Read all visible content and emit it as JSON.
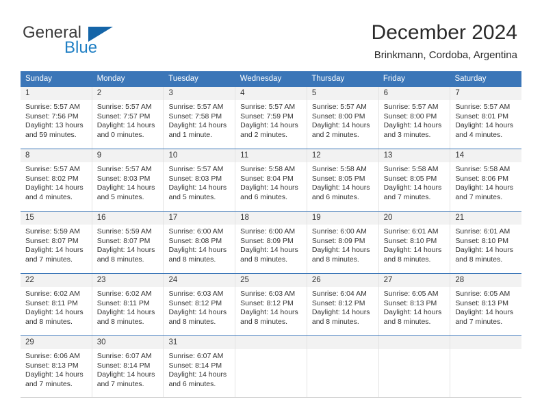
{
  "brand": {
    "name_part1": "General",
    "name_part2": "Blue"
  },
  "header": {
    "title": "December 2024",
    "subtitle": "Brinkmann, Cordoba, Argentina"
  },
  "colors": {
    "header_blue": "#3b76b8",
    "brand_blue": "#1f7fc4",
    "daynum_band": "#f2f2f2",
    "text": "#333333"
  },
  "weekdays": [
    "Sunday",
    "Monday",
    "Tuesday",
    "Wednesday",
    "Thursday",
    "Friday",
    "Saturday"
  ],
  "weeks": [
    [
      {
        "day": "1",
        "sunrise": "Sunrise: 5:57 AM",
        "sunset": "Sunset: 7:56 PM",
        "daylight_line1": "Daylight: 13 hours",
        "daylight_line2": "and 59 minutes."
      },
      {
        "day": "2",
        "sunrise": "Sunrise: 5:57 AM",
        "sunset": "Sunset: 7:57 PM",
        "daylight_line1": "Daylight: 14 hours",
        "daylight_line2": "and 0 minutes."
      },
      {
        "day": "3",
        "sunrise": "Sunrise: 5:57 AM",
        "sunset": "Sunset: 7:58 PM",
        "daylight_line1": "Daylight: 14 hours",
        "daylight_line2": "and 1 minute."
      },
      {
        "day": "4",
        "sunrise": "Sunrise: 5:57 AM",
        "sunset": "Sunset: 7:59 PM",
        "daylight_line1": "Daylight: 14 hours",
        "daylight_line2": "and 2 minutes."
      },
      {
        "day": "5",
        "sunrise": "Sunrise: 5:57 AM",
        "sunset": "Sunset: 8:00 PM",
        "daylight_line1": "Daylight: 14 hours",
        "daylight_line2": "and 2 minutes."
      },
      {
        "day": "6",
        "sunrise": "Sunrise: 5:57 AM",
        "sunset": "Sunset: 8:00 PM",
        "daylight_line1": "Daylight: 14 hours",
        "daylight_line2": "and 3 minutes."
      },
      {
        "day": "7",
        "sunrise": "Sunrise: 5:57 AM",
        "sunset": "Sunset: 8:01 PM",
        "daylight_line1": "Daylight: 14 hours",
        "daylight_line2": "and 4 minutes."
      }
    ],
    [
      {
        "day": "8",
        "sunrise": "Sunrise: 5:57 AM",
        "sunset": "Sunset: 8:02 PM",
        "daylight_line1": "Daylight: 14 hours",
        "daylight_line2": "and 4 minutes."
      },
      {
        "day": "9",
        "sunrise": "Sunrise: 5:57 AM",
        "sunset": "Sunset: 8:03 PM",
        "daylight_line1": "Daylight: 14 hours",
        "daylight_line2": "and 5 minutes."
      },
      {
        "day": "10",
        "sunrise": "Sunrise: 5:57 AM",
        "sunset": "Sunset: 8:03 PM",
        "daylight_line1": "Daylight: 14 hours",
        "daylight_line2": "and 5 minutes."
      },
      {
        "day": "11",
        "sunrise": "Sunrise: 5:58 AM",
        "sunset": "Sunset: 8:04 PM",
        "daylight_line1": "Daylight: 14 hours",
        "daylight_line2": "and 6 minutes."
      },
      {
        "day": "12",
        "sunrise": "Sunrise: 5:58 AM",
        "sunset": "Sunset: 8:05 PM",
        "daylight_line1": "Daylight: 14 hours",
        "daylight_line2": "and 6 minutes."
      },
      {
        "day": "13",
        "sunrise": "Sunrise: 5:58 AM",
        "sunset": "Sunset: 8:05 PM",
        "daylight_line1": "Daylight: 14 hours",
        "daylight_line2": "and 7 minutes."
      },
      {
        "day": "14",
        "sunrise": "Sunrise: 5:58 AM",
        "sunset": "Sunset: 8:06 PM",
        "daylight_line1": "Daylight: 14 hours",
        "daylight_line2": "and 7 minutes."
      }
    ],
    [
      {
        "day": "15",
        "sunrise": "Sunrise: 5:59 AM",
        "sunset": "Sunset: 8:07 PM",
        "daylight_line1": "Daylight: 14 hours",
        "daylight_line2": "and 7 minutes."
      },
      {
        "day": "16",
        "sunrise": "Sunrise: 5:59 AM",
        "sunset": "Sunset: 8:07 PM",
        "daylight_line1": "Daylight: 14 hours",
        "daylight_line2": "and 8 minutes."
      },
      {
        "day": "17",
        "sunrise": "Sunrise: 6:00 AM",
        "sunset": "Sunset: 8:08 PM",
        "daylight_line1": "Daylight: 14 hours",
        "daylight_line2": "and 8 minutes."
      },
      {
        "day": "18",
        "sunrise": "Sunrise: 6:00 AM",
        "sunset": "Sunset: 8:09 PM",
        "daylight_line1": "Daylight: 14 hours",
        "daylight_line2": "and 8 minutes."
      },
      {
        "day": "19",
        "sunrise": "Sunrise: 6:00 AM",
        "sunset": "Sunset: 8:09 PM",
        "daylight_line1": "Daylight: 14 hours",
        "daylight_line2": "and 8 minutes."
      },
      {
        "day": "20",
        "sunrise": "Sunrise: 6:01 AM",
        "sunset": "Sunset: 8:10 PM",
        "daylight_line1": "Daylight: 14 hours",
        "daylight_line2": "and 8 minutes."
      },
      {
        "day": "21",
        "sunrise": "Sunrise: 6:01 AM",
        "sunset": "Sunset: 8:10 PM",
        "daylight_line1": "Daylight: 14 hours",
        "daylight_line2": "and 8 minutes."
      }
    ],
    [
      {
        "day": "22",
        "sunrise": "Sunrise: 6:02 AM",
        "sunset": "Sunset: 8:11 PM",
        "daylight_line1": "Daylight: 14 hours",
        "daylight_line2": "and 8 minutes."
      },
      {
        "day": "23",
        "sunrise": "Sunrise: 6:02 AM",
        "sunset": "Sunset: 8:11 PM",
        "daylight_line1": "Daylight: 14 hours",
        "daylight_line2": "and 8 minutes."
      },
      {
        "day": "24",
        "sunrise": "Sunrise: 6:03 AM",
        "sunset": "Sunset: 8:12 PM",
        "daylight_line1": "Daylight: 14 hours",
        "daylight_line2": "and 8 minutes."
      },
      {
        "day": "25",
        "sunrise": "Sunrise: 6:03 AM",
        "sunset": "Sunset: 8:12 PM",
        "daylight_line1": "Daylight: 14 hours",
        "daylight_line2": "and 8 minutes."
      },
      {
        "day": "26",
        "sunrise": "Sunrise: 6:04 AM",
        "sunset": "Sunset: 8:12 PM",
        "daylight_line1": "Daylight: 14 hours",
        "daylight_line2": "and 8 minutes."
      },
      {
        "day": "27",
        "sunrise": "Sunrise: 6:05 AM",
        "sunset": "Sunset: 8:13 PM",
        "daylight_line1": "Daylight: 14 hours",
        "daylight_line2": "and 8 minutes."
      },
      {
        "day": "28",
        "sunrise": "Sunrise: 6:05 AM",
        "sunset": "Sunset: 8:13 PM",
        "daylight_line1": "Daylight: 14 hours",
        "daylight_line2": "and 7 minutes."
      }
    ],
    [
      {
        "day": "29",
        "sunrise": "Sunrise: 6:06 AM",
        "sunset": "Sunset: 8:13 PM",
        "daylight_line1": "Daylight: 14 hours",
        "daylight_line2": "and 7 minutes."
      },
      {
        "day": "30",
        "sunrise": "Sunrise: 6:07 AM",
        "sunset": "Sunset: 8:14 PM",
        "daylight_line1": "Daylight: 14 hours",
        "daylight_line2": "and 7 minutes."
      },
      {
        "day": "31",
        "sunrise": "Sunrise: 6:07 AM",
        "sunset": "Sunset: 8:14 PM",
        "daylight_line1": "Daylight: 14 hours",
        "daylight_line2": "and 6 minutes."
      },
      {
        "day": "",
        "sunrise": "",
        "sunset": "",
        "daylight_line1": "",
        "daylight_line2": ""
      },
      {
        "day": "",
        "sunrise": "",
        "sunset": "",
        "daylight_line1": "",
        "daylight_line2": ""
      },
      {
        "day": "",
        "sunrise": "",
        "sunset": "",
        "daylight_line1": "",
        "daylight_line2": ""
      },
      {
        "day": "",
        "sunrise": "",
        "sunset": "",
        "daylight_line1": "",
        "daylight_line2": ""
      }
    ]
  ]
}
